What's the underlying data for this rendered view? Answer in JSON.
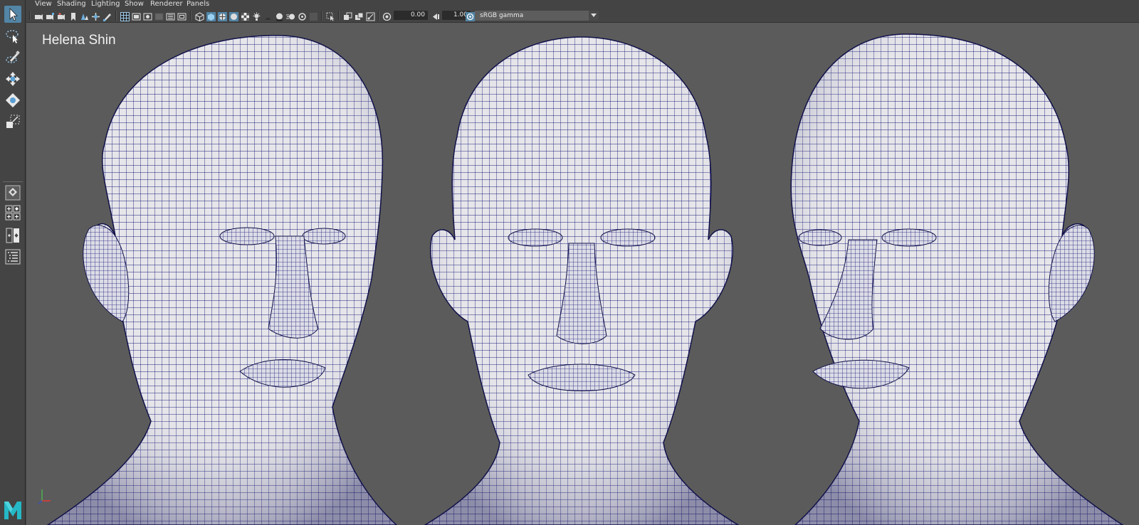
{
  "panel_menu": {
    "items": [
      "View",
      "Shading",
      "Lighting",
      "Show",
      "Renderer",
      "Panels"
    ]
  },
  "panel_toolbar": {
    "exposure_value": "0.00",
    "gamma_value": "1.00",
    "color_space": "sRGB gamma"
  },
  "viewport": {
    "label": "Helena Shin",
    "background_color": "#5b5b5b",
    "wireframe_color": "#1a1a7a",
    "mesh_color": "#e6e6ea",
    "views": [
      "three-quarter-left",
      "front",
      "three-quarter-right"
    ]
  },
  "toolbox": {
    "tools": [
      "select-tool-icon",
      "lasso-tool-icon",
      "paint-select-icon",
      "move-tool-icon",
      "rotate-tool-icon",
      "scale-tool-icon"
    ],
    "layouts": [
      "single-perspective-icon",
      "four-view-icon",
      "two-view-icon",
      "outliner-icon"
    ],
    "accent_color": "#5285a6"
  }
}
